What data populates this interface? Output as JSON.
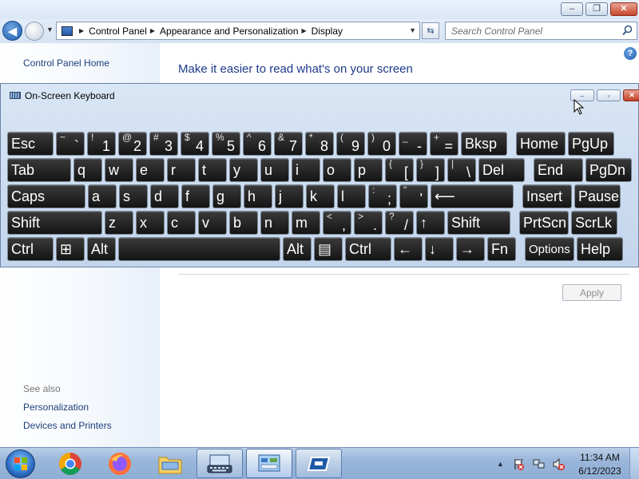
{
  "window": {
    "controls": {
      "minimize": "–",
      "maximize": "❐",
      "close": "✕"
    }
  },
  "address": {
    "crumbs": [
      "Control Panel",
      "Appearance and Personalization",
      "Display"
    ],
    "search_placeholder": "Search Control Panel"
  },
  "sidebar": {
    "home": "Control Panel Home",
    "see_also_label": "See also",
    "links": [
      "Personalization",
      "Devices and Printers"
    ]
  },
  "content": {
    "heading": "Make it easier to read what's on your screen",
    "apply_label": "Apply"
  },
  "osk": {
    "title": "On-Screen Keyboard",
    "rows": [
      [
        {
          "label": "Esc"
        },
        {
          "sec": "~",
          "pri": "`"
        },
        {
          "sec": "!",
          "pri": "1"
        },
        {
          "sec": "@",
          "pri": "2"
        },
        {
          "sec": "#",
          "pri": "3"
        },
        {
          "sec": "$",
          "pri": "4"
        },
        {
          "sec": "%",
          "pri": "5"
        },
        {
          "sec": "^",
          "pri": "6"
        },
        {
          "sec": "&",
          "pri": "7"
        },
        {
          "sec": "*",
          "pri": "8"
        },
        {
          "sec": "(",
          "pri": "9"
        },
        {
          "sec": ")",
          "pri": "0"
        },
        {
          "sec": "_",
          "pri": "-"
        },
        {
          "sec": "+",
          "pri": "="
        },
        {
          "label": "Bksp"
        },
        {
          "label": "Home"
        },
        {
          "label": "PgUp"
        }
      ],
      [
        {
          "label": "Tab"
        },
        {
          "label": "q"
        },
        {
          "label": "w"
        },
        {
          "label": "e"
        },
        {
          "label": "r"
        },
        {
          "label": "t"
        },
        {
          "label": "y"
        },
        {
          "label": "u"
        },
        {
          "label": "i"
        },
        {
          "label": "o"
        },
        {
          "label": "p"
        },
        {
          "sec": "{",
          "pri": "["
        },
        {
          "sec": "}",
          "pri": "]"
        },
        {
          "sec": "|",
          "pri": "\\"
        },
        {
          "label": "Del"
        },
        {
          "label": "End"
        },
        {
          "label": "PgDn"
        }
      ],
      [
        {
          "label": "Caps"
        },
        {
          "label": "a"
        },
        {
          "label": "s"
        },
        {
          "label": "d"
        },
        {
          "label": "f"
        },
        {
          "label": "g"
        },
        {
          "label": "h"
        },
        {
          "label": "j"
        },
        {
          "label": "k"
        },
        {
          "label": "l"
        },
        {
          "sec": ":",
          "pri": ";"
        },
        {
          "sec": "\"",
          "pri": "'"
        },
        {
          "label": "⟵"
        },
        {
          "label": "Insert"
        },
        {
          "label": "Pause"
        }
      ],
      [
        {
          "label": "Shift"
        },
        {
          "label": "z"
        },
        {
          "label": "x"
        },
        {
          "label": "c"
        },
        {
          "label": "v"
        },
        {
          "label": "b"
        },
        {
          "label": "n"
        },
        {
          "label": "m"
        },
        {
          "sec": "<",
          "pri": ","
        },
        {
          "sec": ">",
          "pri": "."
        },
        {
          "sec": "?",
          "pri": "/"
        },
        {
          "label": "↑"
        },
        {
          "label": "Shift"
        },
        {
          "label": "PrtScn"
        },
        {
          "label": "ScrLk"
        }
      ],
      [
        {
          "label": "Ctrl"
        },
        {
          "label": "⊞"
        },
        {
          "label": "Alt"
        },
        {
          "label": ""
        },
        {
          "label": "Alt"
        },
        {
          "label": "▤"
        },
        {
          "label": "Ctrl"
        },
        {
          "label": "←"
        },
        {
          "label": "↓"
        },
        {
          "label": "→"
        },
        {
          "label": "Fn"
        },
        {
          "label": "Options",
          "small": true
        },
        {
          "label": "Help"
        }
      ]
    ]
  },
  "taskbar": {
    "time": "11:34 AM",
    "date": "6/12/2023"
  }
}
